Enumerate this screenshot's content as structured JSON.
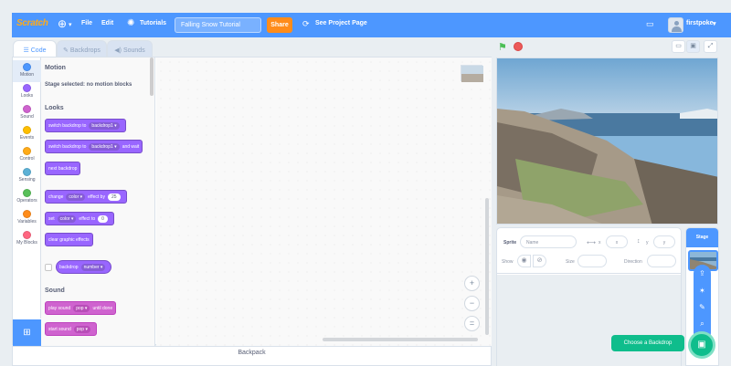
{
  "menubar": {
    "logo_text": "Scratch",
    "file": "File",
    "edit": "Edit",
    "tutorials": "Tutorials",
    "project_title": "Falling Snow Tutorial",
    "share": "Share",
    "see_project_page": "See Project Page",
    "username": "firstpoke",
    "accent_color": "#4d97ff"
  },
  "tabs": [
    {
      "label": "Code",
      "active": true
    },
    {
      "label": "Backdrops",
      "active": false
    },
    {
      "label": "Sounds",
      "active": false
    }
  ],
  "categories": [
    {
      "label": "Motion",
      "color": "#4c97ff"
    },
    {
      "label": "Looks",
      "color": "#9966ff"
    },
    {
      "label": "Sound",
      "color": "#cf63cf"
    },
    {
      "label": "Events",
      "color": "#ffbf00"
    },
    {
      "label": "Control",
      "color": "#ffab19"
    },
    {
      "label": "Sensing",
      "color": "#5cb1d6"
    },
    {
      "label": "Operators",
      "color": "#59c059"
    },
    {
      "label": "Variables",
      "color": "#ff8c1a"
    },
    {
      "label": "My Blocks",
      "color": "#ff6680"
    }
  ],
  "palette": {
    "motion_heading": "Motion",
    "motion_note": "Stage selected: no motion blocks",
    "looks_heading": "Looks",
    "switch_backdrop_to": "switch backdrop to",
    "backdrop1": "backdrop1",
    "switch_backdrop_wait_suffix": "and wait",
    "next_backdrop": "next backdrop",
    "change": "change",
    "color": "color",
    "effect_by": "effect by",
    "effect_by_value": "25",
    "set": "set",
    "effect_to": "effect to",
    "effect_to_value": "0",
    "clear_graphic_effects": "clear graphic effects",
    "backdrop": "backdrop",
    "number": "number",
    "sound_heading": "Sound",
    "play_sound": "play sound",
    "pop": "pop",
    "until_done": "until done",
    "start_sound": "start sound"
  },
  "zoom": {
    "in": "+",
    "out": "−",
    "reset": "="
  },
  "backpack": "Backpack",
  "sprite_info": {
    "sprite_label": "Sprite",
    "name_placeholder": "Name",
    "x_label": "x",
    "x_value": "x",
    "y_label": "y",
    "y_value": "y",
    "show_label": "Show",
    "size_label": "Size",
    "direction_label": "Direction"
  },
  "stage_panel": {
    "header": "Stage"
  },
  "choose_backdrop": "Choose a Backdrop"
}
